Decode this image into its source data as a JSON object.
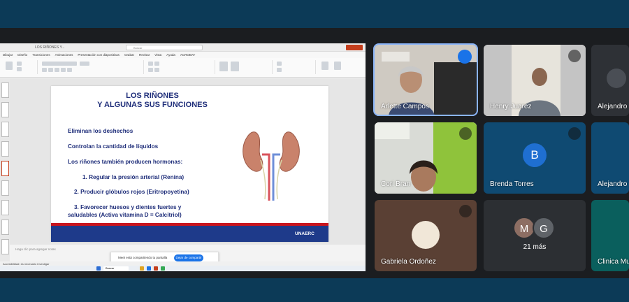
{
  "ppt": {
    "doc_title": "LOS RIÑONES Y...",
    "search_placeholder": "Buscar",
    "menu": [
      "Dibujar",
      "Diseño",
      "Transiciones",
      "Animaciones",
      "Presentación con diapositivas",
      "Grabar",
      "Revisar",
      "Vista",
      "Ayuda",
      "ACROBAT"
    ],
    "notes_placeholder": "Haga clic para agregar notas",
    "notification_text": "Meet está compartiendo tu pantalla",
    "notification_button": "Dejar de compartir",
    "status_text": "Accesibilidad: es necesario investigar",
    "taskbar_search": "Buscar"
  },
  "slide": {
    "title_line1": "LOS RIÑONES",
    "title_line2": "Y ALGUNAS SUS FUNCIONES",
    "point1": "Eliminan los deshechos",
    "point2": "Controlan la cantidad de líquidos",
    "point3": "Los riñones también producen hormonas:",
    "item1": "1. Regular la presión arterial (Renina)",
    "item2": "2. Producir glóbulos rojos (Eritropoyetina)",
    "item3a": "3. Favorecer  huesos y dientes fuertes y",
    "item3b": "saludables (Activa vitamina D = Calcitriol)",
    "logo_text": "UNAERC"
  },
  "participants": [
    {
      "name": "Arlette Campos",
      "muted": false,
      "speaking": true
    },
    {
      "name": "Henry Juarez",
      "muted": true
    },
    {
      "name": "Alejandro",
      "muted": false,
      "pinned": true
    },
    {
      "name": "Cori Bran",
      "muted": true
    },
    {
      "name": "Brenda Torres",
      "muted": true,
      "avatar_letter": "B"
    },
    {
      "name": "Alejandro",
      "muted": false
    },
    {
      "name": "Gabriela Ordoñez",
      "muted": true
    },
    {
      "name": "Clinica Mu",
      "muted": false
    }
  ],
  "more": {
    "count_label": "21 más",
    "avatars": [
      "M",
      "G"
    ]
  },
  "colors": {
    "slide_text": "#1f2e7a",
    "slide_footer": "#1e3a8a",
    "accent_red": "#c9151e",
    "meet_blue": "#1a73e8"
  }
}
